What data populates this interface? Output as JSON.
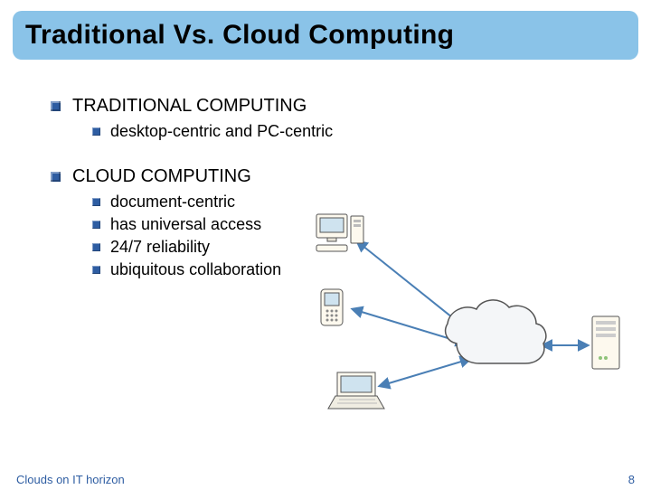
{
  "title": "Traditional Vs. Cloud Computing",
  "section1": {
    "heading": "TRADITIONAL COMPUTING",
    "items": [
      "desktop-centric and PC-centric"
    ]
  },
  "section2": {
    "heading": "CLOUD COMPUTING",
    "items": [
      "document-centric",
      "has universal access",
      "24/7 reliability",
      "ubiquitous collaboration"
    ]
  },
  "footer": {
    "left": "Clouds on IT horizon",
    "right": "8"
  },
  "diagram": {
    "nodes": [
      "desktop-pc",
      "mobile-device",
      "laptop",
      "cloud",
      "server"
    ],
    "description": "Desktop, mobile and laptop clients each connect bidirectionally to a central cloud, which connects bidirectionally to a server."
  }
}
